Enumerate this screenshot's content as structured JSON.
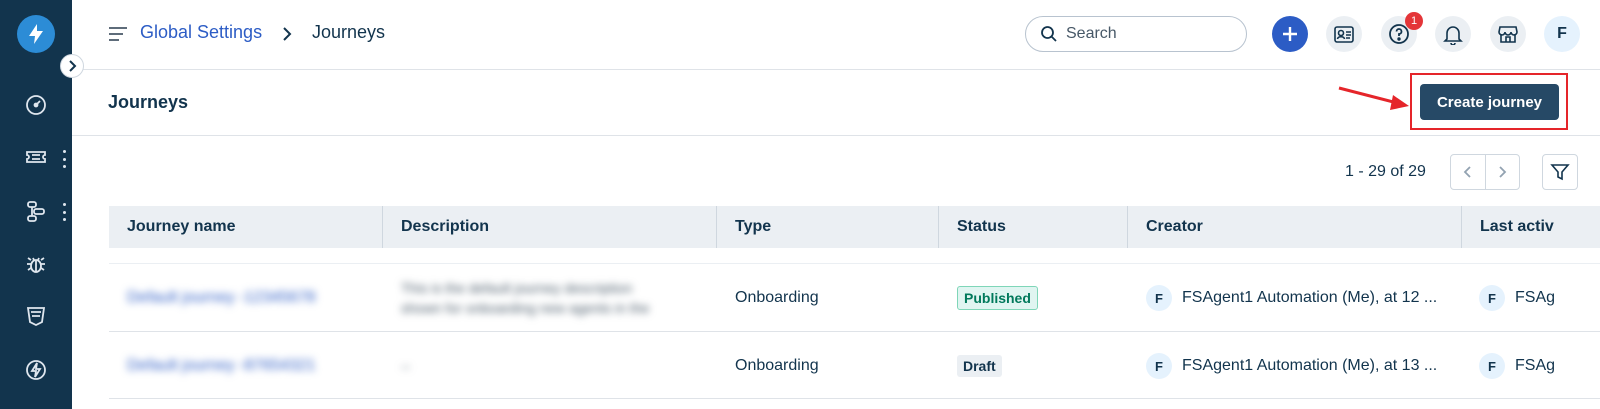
{
  "topbar": {
    "breadcrumb_root": "Global Settings",
    "breadcrumb_current": "Journeys",
    "search_placeholder": "Search",
    "help_badge": "1",
    "user_initial": "F"
  },
  "page": {
    "title": "Journeys",
    "create_button": "Create journey"
  },
  "pagination": {
    "text": "1 - 29 of 29"
  },
  "table": {
    "columns": [
      "Journey name",
      "Description",
      "Type",
      "Status",
      "Creator",
      "Last activ"
    ],
    "rows": [
      {
        "name": "Default journey -12345678",
        "description_line1": "This is the default journey description",
        "description_line2": "shown for onboarding new agents in the",
        "type": "Onboarding",
        "status": "Published",
        "creator_initial": "F",
        "creator": "FSAgent1 Automation (Me), at 12 ...",
        "last_activity_initial": "F",
        "last_activity": "FSAg"
      },
      {
        "name": "Default journey -87654321",
        "description_line1": "--",
        "description_line2": "",
        "type": "Onboarding",
        "status": "Draft",
        "creator_initial": "F",
        "creator": "FSAgent1 Automation (Me), at 13 ...",
        "last_activity_initial": "F",
        "last_activity": "FSAg"
      }
    ]
  },
  "colors": {
    "sidebar_bg": "#12344d",
    "accent": "#2c5cc5",
    "primary_button": "#264966",
    "highlight": "#e5252a"
  }
}
